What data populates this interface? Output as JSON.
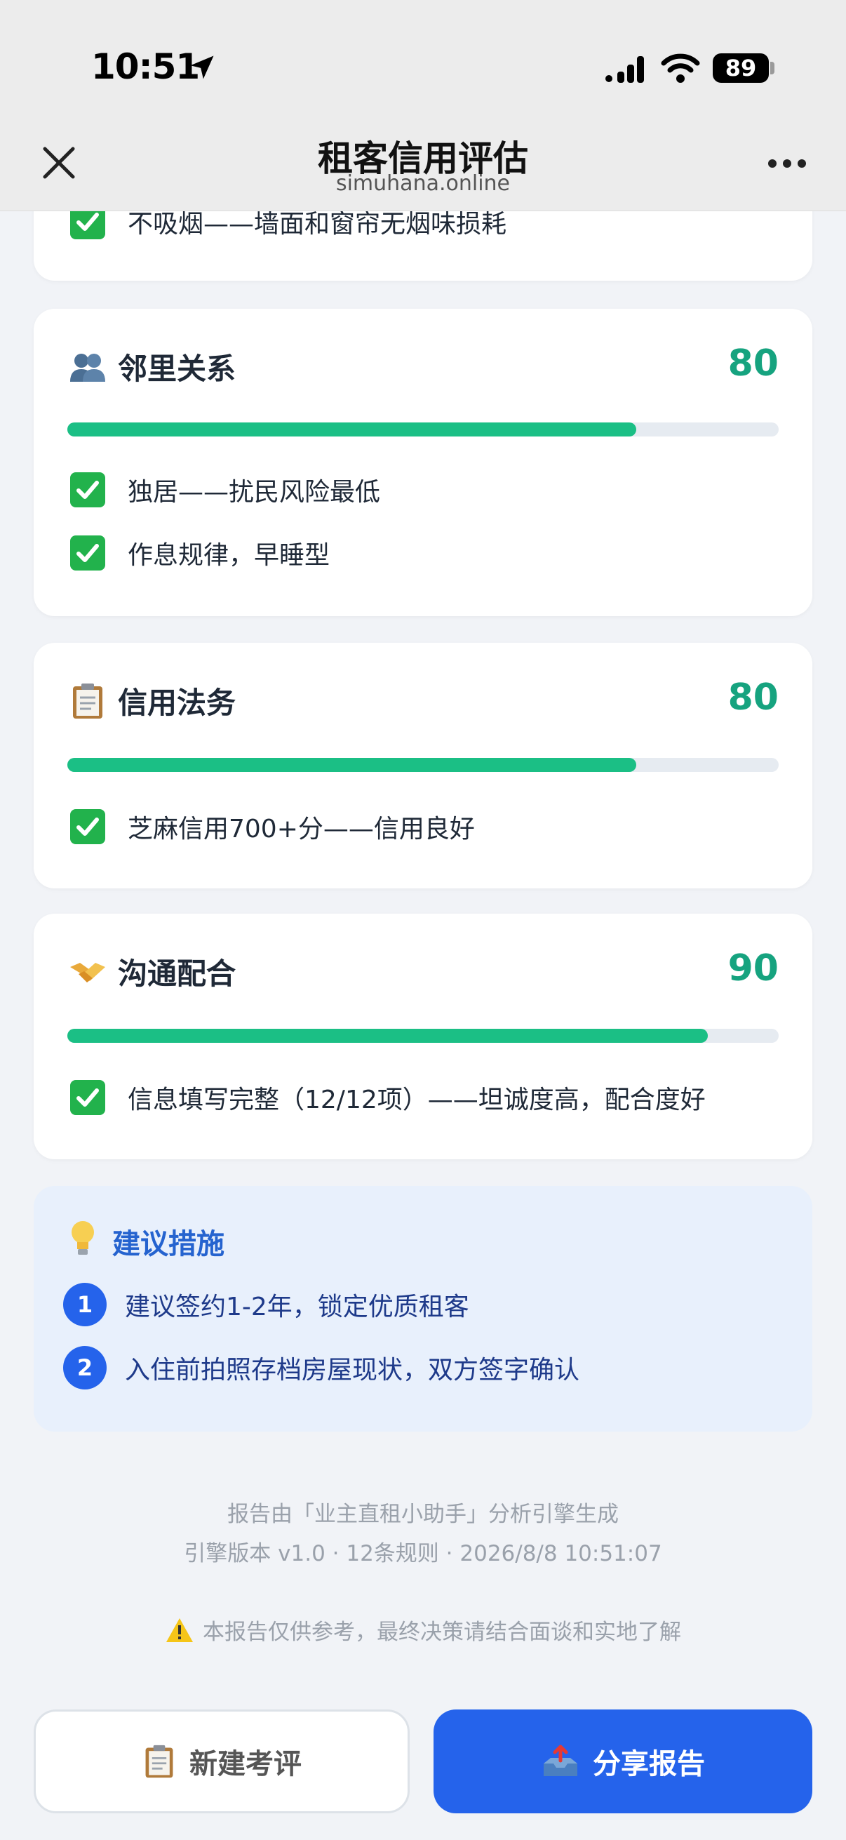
{
  "status_bar": {
    "time": "10:51",
    "battery": "89"
  },
  "nav": {
    "title": "租客信用评估",
    "subtitle": "simuhana.online"
  },
  "top_card": {
    "item": "不吸烟——墙面和窗帘无烟味损耗"
  },
  "sections": [
    {
      "icon": "people-icon",
      "title": "邻里关系",
      "score": "80",
      "score_fraction": 0.8,
      "items": [
        "独居——扰民风险最低",
        "作息规律，早睡型"
      ]
    },
    {
      "icon": "clipboard-icon",
      "title": "信用法务",
      "score": "80",
      "score_fraction": 0.8,
      "items": [
        "芝麻信用700+分——信用良好"
      ]
    },
    {
      "icon": "handshake-icon",
      "title": "沟通配合",
      "score": "90",
      "score_fraction": 0.9,
      "items": [
        "信息填写完整（12/12项）——坦诚度高，配合度好"
      ]
    }
  ],
  "suggestions": {
    "title": "建议措施",
    "items": [
      {
        "num": "1",
        "text": "建议签约1-2年，锁定优质租客"
      },
      {
        "num": "2",
        "text": "入住前拍照存档房屋现状，双方签字确认"
      }
    ]
  },
  "footer": {
    "line1": "报告由「业主直租小助手」分析引擎生成",
    "line2": "引擎版本 v1.0 · 12条规则 · 2026/8/8 10:51:07",
    "warning": "本报告仅供参考，最终决策请结合面谈和实地了解"
  },
  "actions": {
    "new_label": "新建考评",
    "share_label": "分享报告"
  },
  "colors": {
    "accent": "#2563eb",
    "score_green": "#16a37f",
    "bar_green": "#1bbf85",
    "check_green": "#22b24c"
  }
}
